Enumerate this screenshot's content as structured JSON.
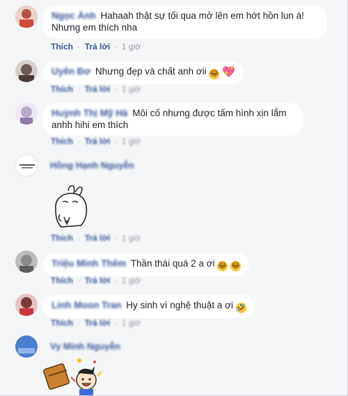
{
  "colors": {
    "background": "#f5f6f7",
    "bubble": "#ffffff",
    "name": "#385898",
    "action": "#385898",
    "meta": "#90949c"
  },
  "actions": {
    "like": "Thích",
    "reply": "Trả lời",
    "separator": "·"
  },
  "comments": [
    {
      "author": "Ngọc Ánh",
      "text": "Hahaah thật sự tối qua mở lên em hớt hồn lun á! Nhưng em thích nha",
      "time": "1 giờ",
      "avatar_color": "#c98a7a"
    },
    {
      "author": "Uyên Đơ",
      "text": "Nhưng đẹp và chất anh ơii",
      "time": "1 giờ",
      "avatar_color": "#6b5a55",
      "emojis": [
        "laughing-crying-emoji",
        "heart-emoji"
      ]
    },
    {
      "author": "Huỳnh Thị Mỹ Hà",
      "text": "Môi cố nhưng được tấm hình xịn lắm anhh hihi em thích",
      "time": "1 giờ",
      "avatar_color": "#b9a9c9"
    },
    {
      "author": "Hồng Hạnh Nguyễn",
      "text": "",
      "time": "1 giờ",
      "avatar_color": "#ffffff",
      "sticker": "bunny-sticker"
    },
    {
      "author": "Triệu Minh Thêm",
      "text": "Thần thái quá 2 a ơi",
      "time": "1 giờ",
      "avatar_color": "#8a8a8a",
      "emojis": [
        "laughing-crying-emoji",
        "laughing-crying-emoji"
      ]
    },
    {
      "author": "Linh Moon Tran",
      "text": "Hy sinh vì nghệ thuật a ơi",
      "time": "1 giờ",
      "avatar_color": "#c9737a",
      "emojis": [
        "rofl-emoji"
      ]
    },
    {
      "author": "Vy Minh Nguyễn",
      "text": "",
      "time": "",
      "avatar_color": "#4a7fd0",
      "sticker": "gift-cartoon-sticker"
    }
  ]
}
